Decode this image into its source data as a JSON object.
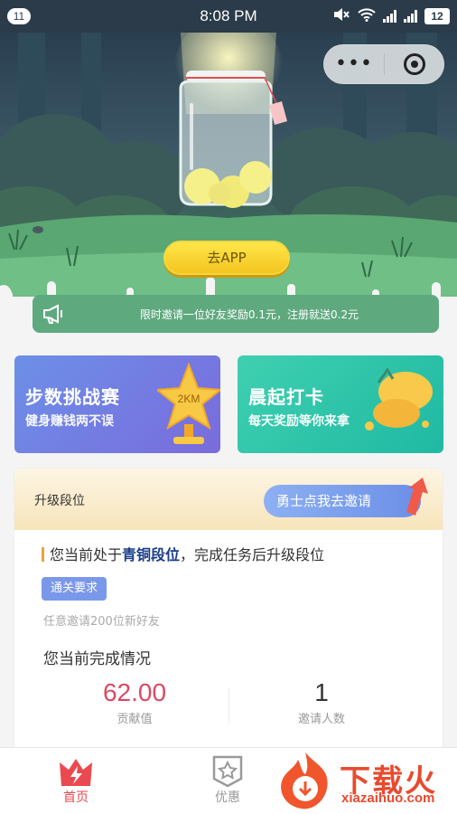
{
  "status_bar": {
    "badge": "11",
    "time": "8:08 PM",
    "battery": "12"
  },
  "hero": {
    "app_button": "去APP"
  },
  "notice": {
    "text": "限时邀请一位好友奖励0.1元，注册就送0.2元"
  },
  "cards": [
    {
      "title": "步数挑战赛",
      "subtitle": "健身赚钱两不误",
      "badge_text": "2KM"
    },
    {
      "title": "晨起打卡",
      "subtitle": "每天奖励等你来拿"
    }
  ],
  "upgrade": {
    "title": "升级段位",
    "invite_button": "勇士点我去邀请",
    "rank_prefix": "您当前处于",
    "rank_name": "青铜段位",
    "rank_suffix": "，完成任务后升级段位",
    "requirement_tag": "通关要求",
    "requirement_text": "任意邀请200位新好友",
    "progress_title": "您当前完成情况",
    "stats": [
      {
        "value": "62.00",
        "label": "贡献值"
      },
      {
        "value": "1",
        "label": "邀请人数"
      }
    ]
  },
  "tabbar": {
    "items": [
      {
        "label": "首页",
        "active": true
      },
      {
        "label": "优惠",
        "active": false
      }
    ]
  },
  "watermark": {
    "brand": "下载火",
    "domain": "xiazaihuo.com"
  },
  "colors": {
    "accent_red": "#e9434e",
    "notice_green": "#5fa97f",
    "stat_red": "#d94a63",
    "rank_blue": "#1a3b8a"
  }
}
